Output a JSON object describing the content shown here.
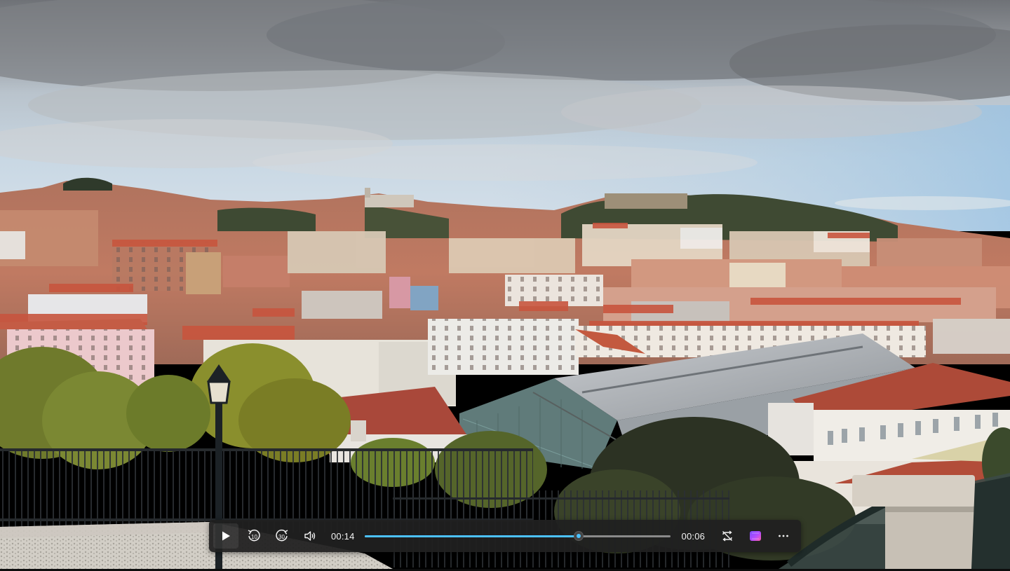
{
  "player": {
    "elapsed_time": "00:14",
    "remaining_time": "00:06",
    "progress": 0.7,
    "accent_color": "#4cc2ff",
    "icons": {
      "play": "play-icon",
      "rewind": "rewind-10-icon",
      "rewind_label": "10",
      "forward": "forward-30-icon",
      "forward_label": "30",
      "volume": "volume-icon",
      "loop": "loop-off-icon",
      "clipchamp": "clipchamp-icon",
      "more": "more-options-icon"
    }
  }
}
